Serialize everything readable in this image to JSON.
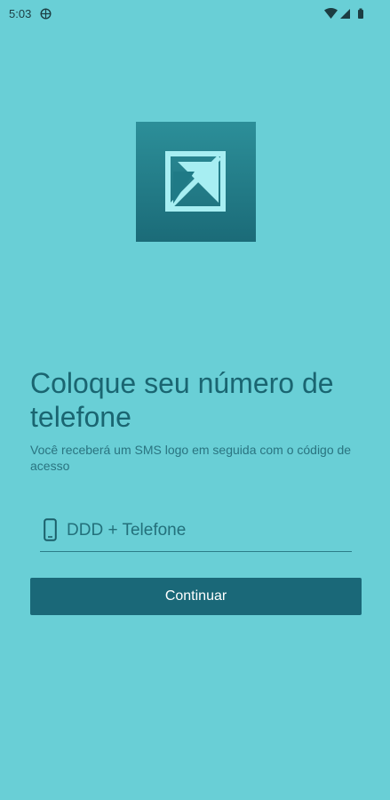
{
  "status_bar": {
    "time": "5:03",
    "left_icon": "location-icon",
    "right_icons": [
      "wifi-icon",
      "signal-icon",
      "battery-icon"
    ]
  },
  "logo": {
    "icon": "logo-arrow-icon"
  },
  "heading": {
    "title": "Coloque seu número de telefone",
    "subtitle": "Você receberá um SMS logo em seguida com o código de acesso"
  },
  "phone_field": {
    "icon": "phone-icon",
    "placeholder": "DDD + Telefone",
    "value": ""
  },
  "continue_button": {
    "label": "Continuar"
  },
  "colors": {
    "background": "#69cfd6",
    "primary": "#1a6878",
    "text": "#1a6571"
  }
}
